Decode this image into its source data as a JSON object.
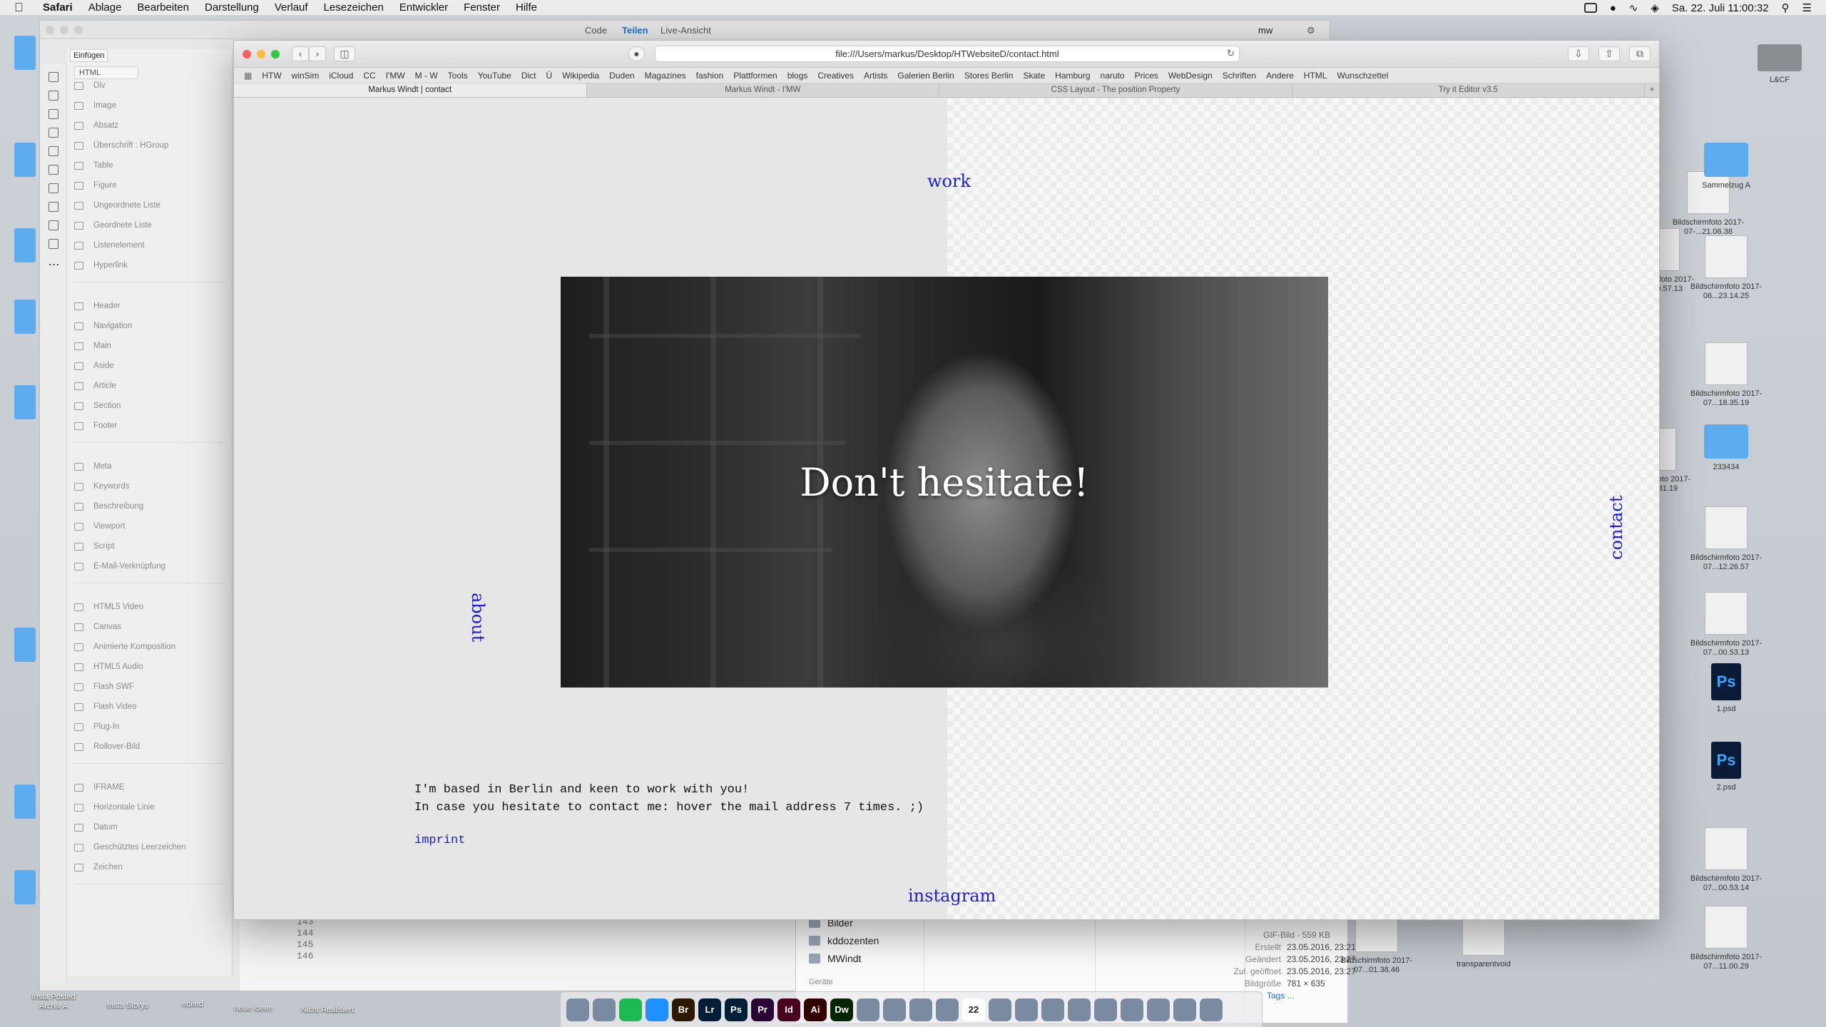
{
  "menubar": {
    "app": "Safari",
    "items": [
      "Ablage",
      "Bearbeiten",
      "Darstellung",
      "Verlauf",
      "Lesezeichen",
      "Entwickler",
      "Fenster",
      "Hilfe"
    ],
    "clock": "Sa. 22. Juli  11:00:32"
  },
  "dreamweaver": {
    "view_code": "Code",
    "view_split": "Teilen",
    "view_live": "Live-Ansicht",
    "workspace": "mw",
    "insert_tab": "Einfügen",
    "insert_category": "HTML",
    "insert_groups": [
      [
        "Div",
        "Image",
        "Absatz",
        "Überschrift : HGroup",
        "Table",
        "Figure",
        "Ungeordnete Liste",
        "Geordnete Liste",
        "Listenelement",
        "Hyperlink"
      ],
      [
        "Header",
        "Navigation",
        "Main",
        "Aside",
        "Article",
        "Section",
        "Footer"
      ],
      [
        "Meta",
        "Keywords",
        "Beschreibung",
        "Viewport",
        "Script",
        "E-Mail-Verknüpfung"
      ],
      [
        "HTML5 Video",
        "Canvas",
        "Animierte Komposition",
        "HTML5 Audio",
        "Flash SWF",
        "Flash Video",
        "Plug-In",
        "Rollover-Bild"
      ],
      [
        "IFRAME",
        "Horizontale Linie",
        "Datum",
        "Geschütztes Leerzeichen",
        "Zeichen"
      ]
    ],
    "code_lines": [
      "143",
      "144",
      "145",
      "146"
    ]
  },
  "finder": {
    "items": [
      "Bilder",
      "kddozenten",
      "MWindt"
    ],
    "devices_label": "Geräte",
    "file_kind": "GIF-Bild - 559 KB",
    "meta": [
      {
        "label": "Erstellt",
        "value": "23.05.2016, 23:21"
      },
      {
        "label": "Geändert",
        "value": "23.05.2016, 23:27"
      },
      {
        "label": "Zul. geöffnet",
        "value": "23.05.2016, 23:27"
      },
      {
        "label": "Bildgröße",
        "value": "781 × 635"
      }
    ],
    "tags": "Tags ..."
  },
  "safari": {
    "url": "file:///Users/markus/Desktop/HTWebsiteD/contact.html",
    "bookmarks": [
      "HTW",
      "winSim",
      "iCloud",
      "CC",
      "I'MW",
      "M - W",
      "Tools",
      "YouTube",
      "Dict",
      "Ü",
      "Wikipedia",
      "Duden",
      "Magazines",
      "fashion",
      "Plattformen",
      "blogs",
      "Creatives",
      "Artists",
      "Galerien Berlin",
      "Stores Berlin",
      "Skate",
      "Hamburg",
      "naruto",
      "Prices",
      "WebDesign",
      "Schriften",
      "Andere",
      "HTML",
      "Wunschzettel"
    ],
    "tabs": [
      "Markus Windt | contact",
      "Markus Windt - I'MW",
      "CSS Layout - The position Property",
      "Try it Editor v3.5"
    ]
  },
  "page": {
    "nav_work": "work",
    "nav_about": "about",
    "nav_contact": "contact",
    "nav_instagram": "instagram",
    "hero_title": "Don't hesitate!",
    "body_line1": "I'm based in Berlin and keen to work with you!",
    "body_line2": "In case you hesitate to contact me: hover the mail address 7 times. ;)",
    "imprint": "imprint"
  },
  "desktop": {
    "right_icons": [
      {
        "label": "Bildschirmfoto 2017-07-...21.06.38",
        "kind": "image"
      },
      {
        "label": "Bildschirmfoto 2017-07-...20.57.13",
        "kind": "image"
      },
      {
        "label": "Bildschirmfoto 2017-06...23.14.25",
        "kind": "image"
      },
      {
        "label": "Sammelzug A",
        "kind": "folder"
      },
      {
        "label": "Bildschirmfoto 2017-07...18.35.19",
        "kind": "image"
      },
      {
        "label": "Bildschirmfoto 2017-07...22.31.19",
        "kind": "image"
      },
      {
        "label": "233434",
        "kind": "folder"
      },
      {
        "label": "Bildschirmfoto 2017-07...12.26.57",
        "kind": "image"
      },
      {
        "label": "Bildschirmfoto 2017-07...00.53.13",
        "kind": "image"
      },
      {
        "label": "1.psd",
        "kind": "psd"
      },
      {
        "label": "2.psd",
        "kind": "psd"
      },
      {
        "label": "Bildschirmfoto 2017-07...00.53.14",
        "kind": "image"
      },
      {
        "label": "Bildschirmfoto 2017-07...11.00.29",
        "kind": "image"
      },
      {
        "label": "Bildschirmfoto 2017-07...01.38.46",
        "kind": "image"
      },
      {
        "label": "transparentvoid",
        "kind": "image"
      }
    ],
    "disk_label": "L&CF",
    "bottom_labels": [
      "Insta Posted Archiv A",
      "Insta Storys",
      "edited",
      "neue ideen",
      "Nicht Realisiert"
    ]
  },
  "dock": {
    "apps": [
      "Finder",
      "Launchpad",
      "Spotify",
      "Safari",
      "Br",
      "Lr",
      "Ps",
      "Pr",
      "Id",
      "Ai",
      "Dw",
      "Dashcode",
      "Mail",
      "GitHub",
      "Preview",
      "Kalender",
      "Notizen",
      "Pages",
      "Erinnerungen",
      "Fotos",
      "QuickTime",
      "Systemeinstellungen",
      "Downloads",
      "Terminal",
      "Papierkorb"
    ],
    "calendar_day": "22",
    "colors": {
      "spotify": "#1db954",
      "safari": "#1e90ff",
      "br": "#2c1a00",
      "lr": "#001e36",
      "ps": "#001e36",
      "pr": "#2a0634",
      "id": "#49021f",
      "ai": "#330000",
      "dw": "#072401"
    }
  },
  "theme": {
    "link_blue": "#1d1dd0",
    "page_bg": "#e6e6e6"
  }
}
